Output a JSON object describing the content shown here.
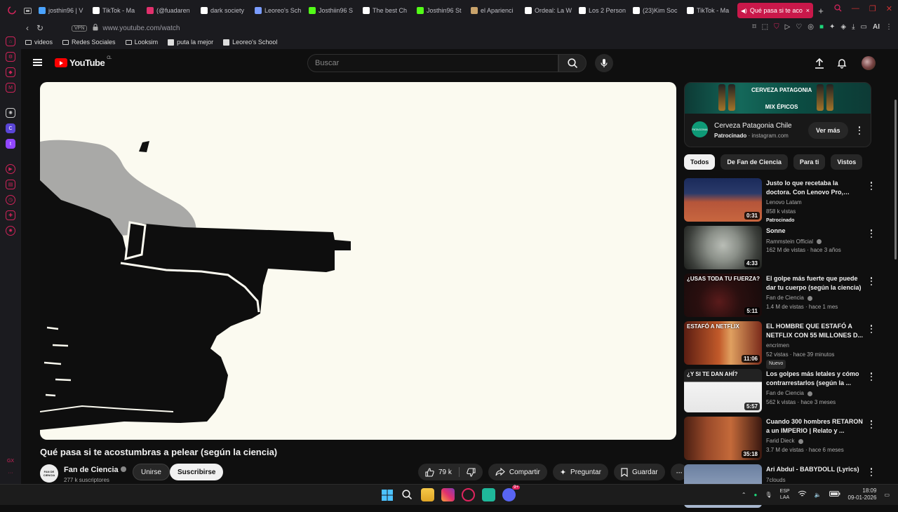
{
  "browser": {
    "tabs": [
      {
        "label": "josthin96 | V",
        "color": "#4aa3ff"
      },
      {
        "label": "TikTok - Ma",
        "color": "#ffffff"
      },
      {
        "label": "(@fuadaren",
        "color": "#e1306c"
      },
      {
        "label": "dark society",
        "color": "#ffffff"
      },
      {
        "label": "Leoreo's Sch",
        "color": "#7a9cff"
      },
      {
        "label": "Josthiin96 S",
        "color": "#53fc18"
      },
      {
        "label": "The best Ch",
        "color": "#ffffff"
      },
      {
        "label": "Josthin96 St",
        "color": "#53fc18"
      },
      {
        "label": "el Aparienci",
        "color": "#c9a36b"
      },
      {
        "label": "Ordeal: La W",
        "color": "#ffffff"
      },
      {
        "label": "Los 2 Person",
        "color": "#ffffff"
      },
      {
        "label": "(23)Kim Soc",
        "color": "#ffffff"
      },
      {
        "label": "TikTok - Ma",
        "color": "#ffffff"
      }
    ],
    "active_tab": "Qué pasa si te aco",
    "vpn": "VPN",
    "url": "www.youtube.com/watch",
    "ai_label": "AI",
    "bookmarks": [
      {
        "label": "videos",
        "kind": "folder"
      },
      {
        "label": "Redes Sociales",
        "kind": "folder"
      },
      {
        "label": "Looksim",
        "kind": "folder"
      },
      {
        "label": "puta la mejor",
        "kind": "page"
      },
      {
        "label": "Leoreo's School",
        "kind": "page"
      }
    ],
    "sidebar_bottom": "GX"
  },
  "youtube": {
    "logo_text": "YouTube",
    "country": "CL",
    "search_placeholder": "Buscar",
    "video": {
      "title": "Qué pasa si te acostumbras a pelear (según la ciencia)",
      "channel": "Fan de Ciencia",
      "channel_avatar_text": "FAN DE CIENCIA",
      "subscribers": "277 k suscriptores",
      "join": "Unirse",
      "subscribe": "Suscribirse",
      "likes": "79 k",
      "share": "Compartir",
      "ask": "Preguntar",
      "save": "Guardar"
    },
    "ad": {
      "banner_title": "CERVEZA PATAGONIA",
      "banner_sub": "MIX ÉPICOS",
      "logo_text": "PATAGONIA",
      "name": "Cerveza Patagonia Chile",
      "sponsored": "Patrocinado",
      "domain": "instagram.com",
      "cta": "Ver más"
    },
    "chips": [
      "Todos",
      "De Fan de Ciencia",
      "Para ti",
      "Vistos"
    ],
    "recommendations": [
      {
        "title": "Justo lo que recetaba la doctora. Con Lenovo Pro, Susa...",
        "channel": "Lenovo Latam",
        "views": "858 k vistas",
        "age": "",
        "badge": "Patrocinado",
        "duration": "0:31",
        "thumb": "linear-gradient(180deg,#1a2a5a 0,#2a3a6a 35%,#b5553a 55%,#c8663f 100%)",
        "verified": false
      },
      {
        "title": "Sonne",
        "channel": "Rammstein Official",
        "views": "162 M de vistas",
        "age": "hace 3 años",
        "badge": "",
        "duration": "4:33",
        "thumb": "radial-gradient(circle at 50% 45%,#b9bdb6 0,#8a8f88 35%,#3d403c 75%,#1d1f1c 100%)",
        "verified": true
      },
      {
        "title": "El golpe más fuerte que puede dar tu cuerpo (según la ciencia)",
        "channel": "Fan de Ciencia",
        "views": "1.4 M de vistas",
        "age": "hace 1 mes",
        "badge": "",
        "duration": "5:11",
        "thumb": "radial-gradient(circle at 45% 65%,#5a1b1b 0,#2a0f0f 40%,#140a0a 100%)",
        "verified": true,
        "overlay": "¿USAS TODA TU FUERZA?"
      },
      {
        "title": "EL HOMBRE QUE ESTAFÓ A NETFLIX CON 55 MILLONES D...",
        "channel": "encrimen",
        "views": "52 vistas",
        "age": "hace 39 minutos",
        "badge": "Nuevo",
        "duration": "11:06",
        "thumb": "linear-gradient(90deg,#5b1d12 0,#c25a2a 45%,#e0a060 60%,#7a2a1a 100%)",
        "verified": false,
        "overlay": "ESTAFÓ A NETFLIX"
      },
      {
        "title": "Los golpes más letales y cómo contrarrestarlos (según la ...",
        "channel": "Fan de Ciencia",
        "views": "562 k vistas",
        "age": "hace 3 meses",
        "badge": "",
        "duration": "5:57",
        "thumb": "linear-gradient(180deg,#222 0,#222 30%,#f4f4f4 30%,#e6e6e6 100%)",
        "verified": true,
        "overlay": "¿Y SI TE DAN AHÍ?"
      },
      {
        "title": "Cuando 300 hombres RETARON a un IMPERIO | Relato y ...",
        "channel": "Farid Dieck",
        "views": "3.7 M de vistas",
        "age": "hace 6 meses",
        "badge": "",
        "duration": "35:18",
        "thumb": "linear-gradient(90deg,#4a1f12 0,#9a4a2a 30%,#c46a3a 60%,#3a1810 100%)",
        "verified": true
      },
      {
        "title": "Ari Abdul - BABYDOLL (Lyrics)",
        "channel": "7clouds",
        "views": "",
        "age": "",
        "badge": "",
        "duration": "",
        "thumb": "linear-gradient(180deg,#6a7fa0 0,#a9b8cf 100%)",
        "verified": false
      }
    ]
  },
  "taskbar": {
    "lang_1": "ESP",
    "lang_2": "LAA",
    "time": "18:09",
    "date": "09-01-2026",
    "chat_badge": "9+"
  },
  "colors": {
    "accent": "#c9184a",
    "yt_red": "#ff0000",
    "bg": "#0f0f0f"
  }
}
